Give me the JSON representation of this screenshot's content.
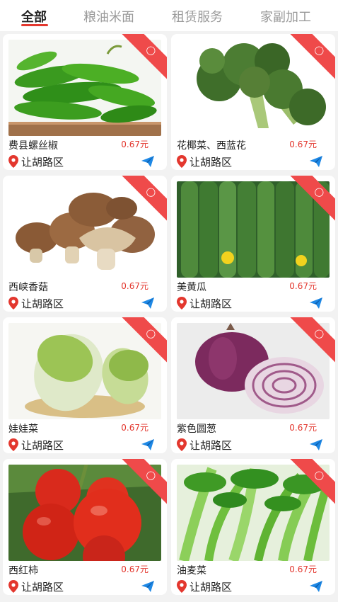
{
  "tabs": [
    "全部",
    "粮油米面",
    "租赁服务",
    "家副加工"
  ],
  "colors": {
    "accent": "#e3372e",
    "ribbon": "#ef4a4a",
    "send_icon": "#1e88e5"
  },
  "products": [
    {
      "name": "费县螺丝椒",
      "price": "0.67元",
      "location": "让胡路区",
      "badge_icon": "tag-icon"
    },
    {
      "name": "花椰菜、西蓝花",
      "price": "0.67元",
      "location": "让胡路区",
      "badge_icon": "tag-icon"
    },
    {
      "name": "西峡香菇",
      "price": "0.67元",
      "location": "让胡路区",
      "badge_icon": "tag-icon"
    },
    {
      "name": "美黄瓜",
      "price": "0.67元",
      "location": "让胡路区",
      "badge_icon": "tag-icon"
    },
    {
      "name": "娃娃菜",
      "price": "0.67元",
      "location": "让胡路区",
      "badge_icon": "tag-icon"
    },
    {
      "name": "紫色圆葱",
      "price": "0.67元",
      "location": "让胡路区",
      "badge_icon": "tag-icon"
    },
    {
      "name": "西红柿",
      "price": "0.67元",
      "location": "让胡路区",
      "badge_icon": "tag-icon"
    },
    {
      "name": "油麦菜",
      "price": "0.67元",
      "location": "让胡路区",
      "badge_icon": "tag-icon"
    }
  ]
}
